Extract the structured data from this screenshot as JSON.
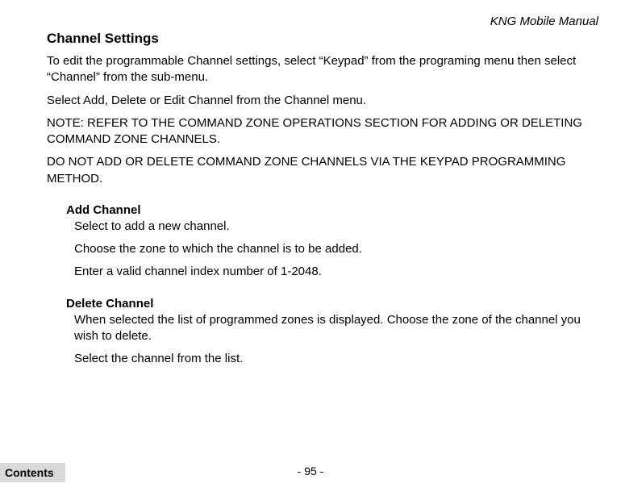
{
  "header": {
    "doc_title": "KNG Mobile Manual"
  },
  "main": {
    "heading": "Channel Settings",
    "p1": "To edit the programmable Channel settings, select “Keypad” from the programing menu then select “Channel” from the sub-menu.",
    "p2": "Select Add, Delete or Edit Channel from the Channel menu.",
    "p3": "NOTE: REFER TO THE COMMAND ZONE OPERATIONS SECTION FOR ADDING OR DELETING COMMAND ZONE CHANNELS.",
    "p4": "DO NOT ADD OR DELETE COMMAND ZONE CHANNELS VIA THE KEYPAD PROGRAMMING METHOD."
  },
  "add_channel": {
    "heading": "Add Channel",
    "p1": "Select to add a new channel.",
    "p2": "Choose the zone to which the channel is to be added.",
    "p3": "Enter a valid channel index number of 1-2048."
  },
  "delete_channel": {
    "heading": "Delete Channel",
    "p1": "When selected the list of programmed zones is displayed. Choose the zone of the channel you wish to delete.",
    "p2": "Select the channel from the list."
  },
  "footer": {
    "page_number": "- 95 -",
    "contents_label": "Contents"
  }
}
